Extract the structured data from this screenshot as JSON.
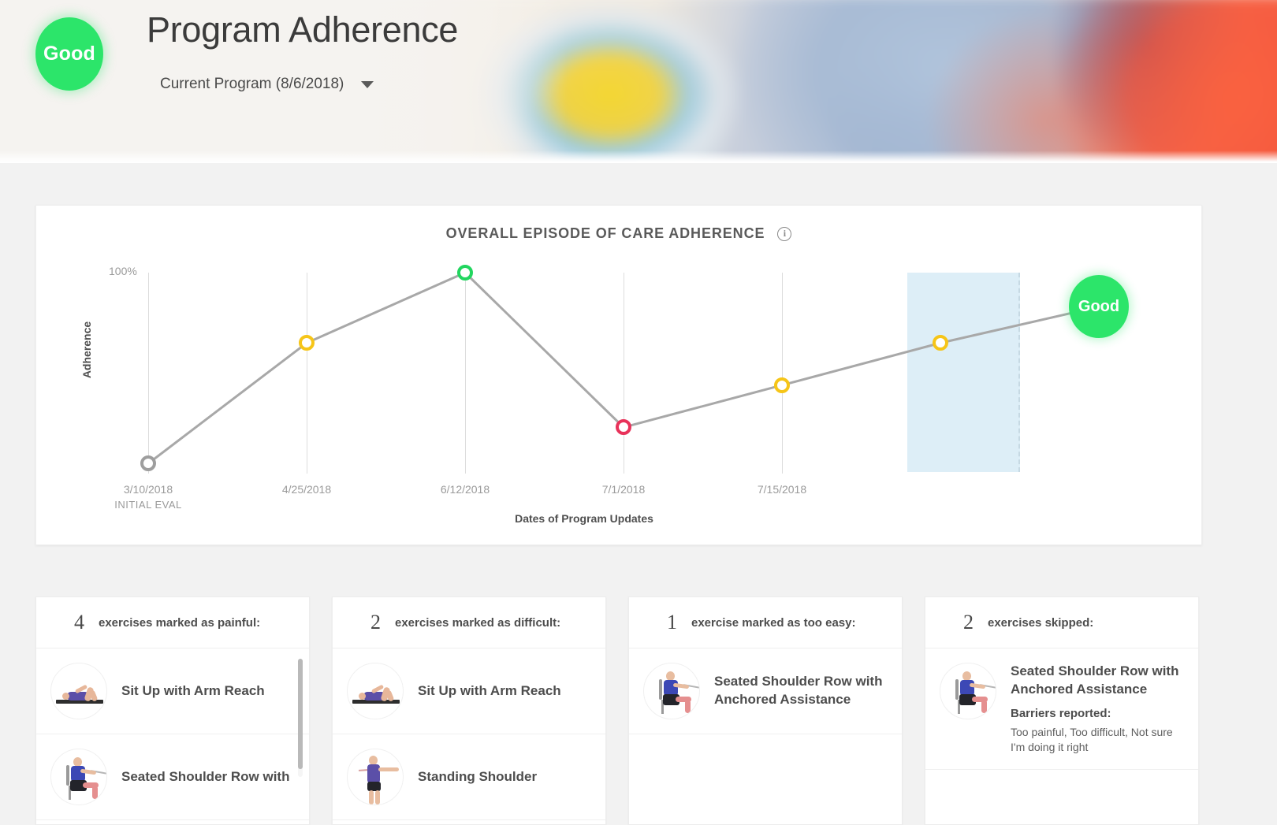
{
  "header": {
    "badge_label": "Good",
    "title": "Program Adherence",
    "program_selector_label": "Current Program (8/6/2018)",
    "caret_icon": "chevron-down-icon"
  },
  "chart_card": {
    "title": "OVERALL EPISODE OF CARE ADHERENCE",
    "info_icon": "info-icon"
  },
  "chart_data": {
    "type": "line",
    "title": "OVERALL EPISODE OF CARE ADHERENCE",
    "xlabel": "Dates of Program Updates",
    "ylabel": "Adherence",
    "y_top_tick": "100%",
    "ylim": [
      0,
      100
    ],
    "grid": "vertical",
    "legend": "none",
    "categories": [
      "3/10/2018",
      "4/25/2018",
      "6/12/2018",
      "7/1/2018",
      "7/15/2018",
      "",
      ""
    ],
    "category_sublabels": [
      "INITIAL EVAL",
      "",
      "",
      "",
      "",
      "",
      ""
    ],
    "values": [
      5,
      65,
      100,
      23,
      44,
      65,
      83
    ],
    "point_statuses": [
      "none",
      "fair",
      "good",
      "poor",
      "fair",
      "fair",
      "good"
    ],
    "status_colors": {
      "none": "#9e9e9e",
      "good": "#22d65f",
      "fair": "#f6c518",
      "poor": "#e8325a"
    },
    "line_color": "#a8a8a8",
    "current_point_label": "Good",
    "highlight_band": {
      "label": "current program window",
      "fill": "#ddeef7"
    }
  },
  "cards": [
    {
      "count": "4",
      "label": "exercises marked as painful:",
      "icon_name": "painful-card",
      "items": [
        {
          "title": "Sit Up with Arm Reach",
          "figure": "fig-situp"
        },
        {
          "title": "Seated Shoulder Row with",
          "figure": "fig-seated"
        }
      ],
      "has_scrollbar": true
    },
    {
      "count": "2",
      "label": "exercises marked as difficult:",
      "icon_name": "difficult-card",
      "items": [
        {
          "title": "Sit Up with Arm Reach",
          "figure": "fig-situp"
        },
        {
          "title": "Standing Shoulder",
          "figure": "fig-stand"
        }
      ],
      "has_scrollbar": false
    },
    {
      "count": "1",
      "label": "exercise marked as too easy:",
      "icon_name": "too-easy-card",
      "items": [
        {
          "title": "Seated Shoulder Row with Anchored Assistance",
          "figure": "fig-seated"
        }
      ],
      "has_scrollbar": false
    },
    {
      "count": "2",
      "label": "exercises skipped:",
      "icon_name": "skipped-card",
      "items": [
        {
          "title": "Seated Shoulder Row with Anchored Assistance",
          "figure": "fig-seated",
          "barriers_label": "Barriers reported:",
          "barriers_text": "Too painful, Too difficult, Not sure I'm doing it right"
        }
      ],
      "has_scrollbar": false
    }
  ]
}
